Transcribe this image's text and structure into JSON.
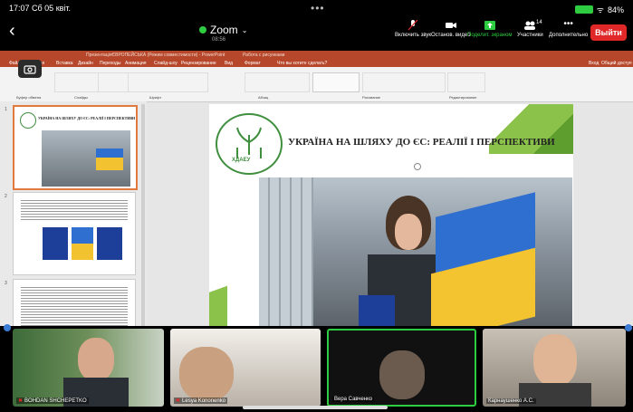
{
  "status": {
    "time": "17:07  Сб 05 квіт.",
    "dots": "•••",
    "battery": "84%"
  },
  "zoom": {
    "title": "Zoom",
    "timer": "08:56",
    "back": "‹",
    "toolbar": [
      {
        "label": "Включить звук",
        "icon": "microphone-muted-icon"
      },
      {
        "label": "Останов. видео",
        "icon": "video-camera-icon"
      },
      {
        "label": "Поделит. экраном",
        "icon": "share-screen-icon"
      },
      {
        "label": "Участники",
        "icon": "participants-icon",
        "count": "14"
      },
      {
        "label": "Дополнительно",
        "icon": "more-icon"
      }
    ],
    "leave": "Выйти"
  },
  "ppt": {
    "title": "ПрезентаціяЄВРОПЕЙСЬКА (Режим совместимости) - PowerPoint",
    "tools": "Работа с рисунками",
    "menu": [
      "Файл",
      "Главная",
      "Вставка",
      "Дизайн",
      "Переходы",
      "Анимация",
      "Слайд-шоу",
      "Рецензирование",
      "Вид",
      "Формат",
      "Что вы хотите сделать?"
    ],
    "share_label": "Вход",
    "share2": "Общий доступ",
    "ribbon_groups": [
      "Буфер обмена",
      "Слайды",
      "Шрифт",
      "Абзац",
      "Рисование",
      "Редактирование"
    ]
  },
  "slides": [
    {
      "num": "1",
      "title": "УКРАЇНА НА ШЛЯХУ ДО ЄС: РЕАЛІЇ І ПЕРСПЕКТИВИ"
    },
    {
      "num": "2"
    },
    {
      "num": "3"
    }
  ],
  "main_slide": {
    "title": "УКРАЇНА НА ШЛЯХУ ДО ЄС: РЕАЛІЇ І ПЕРСПЕКТИВИ",
    "logo_text": "ХДАЕУ"
  },
  "participants": [
    {
      "name": "BOHDAN SHCHEPETKO",
      "muted": true
    },
    {
      "name": "Lesya Kononenko",
      "muted": true
    },
    {
      "name": "Вера Савченко",
      "muted": false
    },
    {
      "name": "Карнаушенко А.С.",
      "muted": false
    }
  ]
}
